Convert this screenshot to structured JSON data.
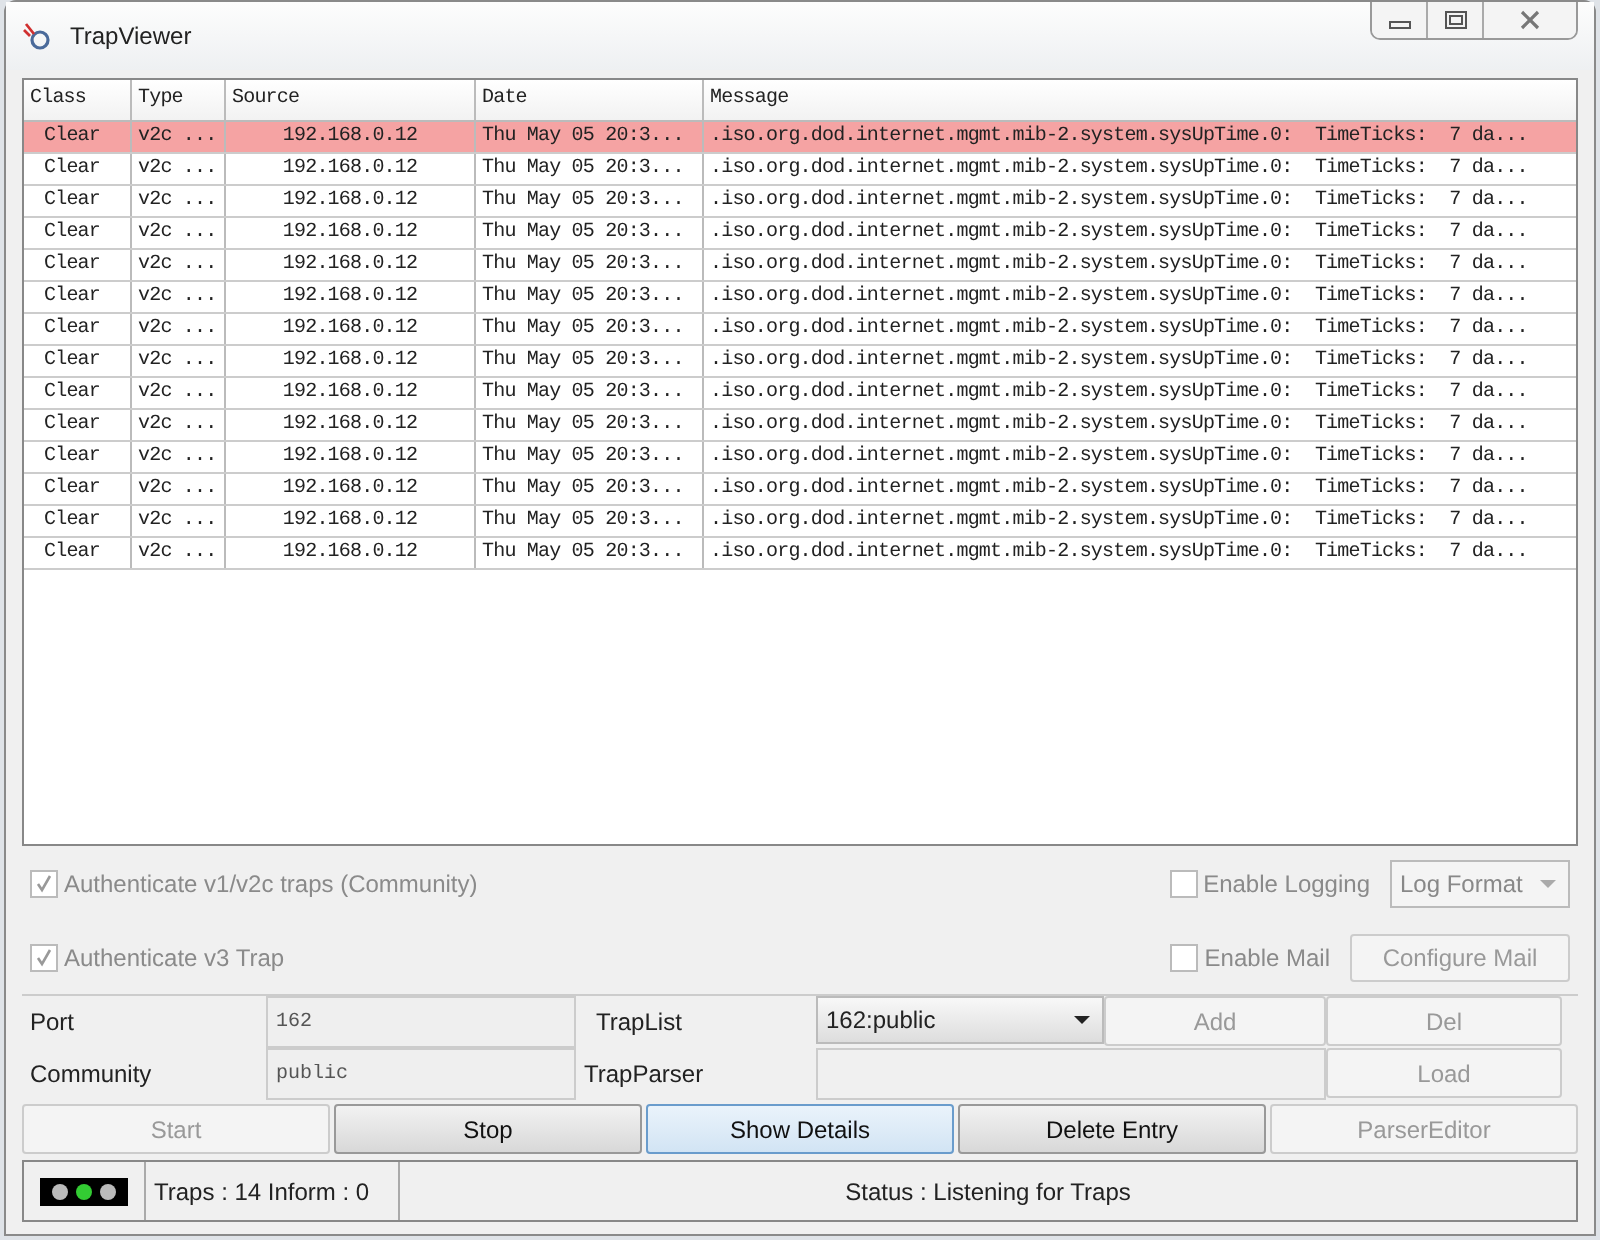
{
  "window": {
    "title": "TrapViewer"
  },
  "table": {
    "columns": [
      "Class",
      "Type",
      "Source",
      "Date",
      "Message"
    ],
    "rows": [
      {
        "selected": true,
        "cells": [
          "Clear",
          "v2c ...",
          "192.168.0.12",
          "Thu May 05 20:3...",
          ".iso.org.dod.internet.mgmt.mib-2.system.sysUpTime.0:  TimeTicks:  7 da..."
        ]
      },
      {
        "selected": false,
        "cells": [
          "Clear",
          "v2c ...",
          "192.168.0.12",
          "Thu May 05 20:3...",
          ".iso.org.dod.internet.mgmt.mib-2.system.sysUpTime.0:  TimeTicks:  7 da..."
        ]
      },
      {
        "selected": false,
        "cells": [
          "Clear",
          "v2c ...",
          "192.168.0.12",
          "Thu May 05 20:3...",
          ".iso.org.dod.internet.mgmt.mib-2.system.sysUpTime.0:  TimeTicks:  7 da..."
        ]
      },
      {
        "selected": false,
        "cells": [
          "Clear",
          "v2c ...",
          "192.168.0.12",
          "Thu May 05 20:3...",
          ".iso.org.dod.internet.mgmt.mib-2.system.sysUpTime.0:  TimeTicks:  7 da..."
        ]
      },
      {
        "selected": false,
        "cells": [
          "Clear",
          "v2c ...",
          "192.168.0.12",
          "Thu May 05 20:3...",
          ".iso.org.dod.internet.mgmt.mib-2.system.sysUpTime.0:  TimeTicks:  7 da..."
        ]
      },
      {
        "selected": false,
        "cells": [
          "Clear",
          "v2c ...",
          "192.168.0.12",
          "Thu May 05 20:3...",
          ".iso.org.dod.internet.mgmt.mib-2.system.sysUpTime.0:  TimeTicks:  7 da..."
        ]
      },
      {
        "selected": false,
        "cells": [
          "Clear",
          "v2c ...",
          "192.168.0.12",
          "Thu May 05 20:3...",
          ".iso.org.dod.internet.mgmt.mib-2.system.sysUpTime.0:  TimeTicks:  7 da..."
        ]
      },
      {
        "selected": false,
        "cells": [
          "Clear",
          "v2c ...",
          "192.168.0.12",
          "Thu May 05 20:3...",
          ".iso.org.dod.internet.mgmt.mib-2.system.sysUpTime.0:  TimeTicks:  7 da..."
        ]
      },
      {
        "selected": false,
        "cells": [
          "Clear",
          "v2c ...",
          "192.168.0.12",
          "Thu May 05 20:3...",
          ".iso.org.dod.internet.mgmt.mib-2.system.sysUpTime.0:  TimeTicks:  7 da..."
        ]
      },
      {
        "selected": false,
        "cells": [
          "Clear",
          "v2c ...",
          "192.168.0.12",
          "Thu May 05 20:3...",
          ".iso.org.dod.internet.mgmt.mib-2.system.sysUpTime.0:  TimeTicks:  7 da..."
        ]
      },
      {
        "selected": false,
        "cells": [
          "Clear",
          "v2c ...",
          "192.168.0.12",
          "Thu May 05 20:3...",
          ".iso.org.dod.internet.mgmt.mib-2.system.sysUpTime.0:  TimeTicks:  7 da..."
        ]
      },
      {
        "selected": false,
        "cells": [
          "Clear",
          "v2c ...",
          "192.168.0.12",
          "Thu May 05 20:3...",
          ".iso.org.dod.internet.mgmt.mib-2.system.sysUpTime.0:  TimeTicks:  7 da..."
        ]
      },
      {
        "selected": false,
        "cells": [
          "Clear",
          "v2c ...",
          "192.168.0.12",
          "Thu May 05 20:3...",
          ".iso.org.dod.internet.mgmt.mib-2.system.sysUpTime.0:  TimeTicks:  7 da..."
        ]
      },
      {
        "selected": false,
        "cells": [
          "Clear",
          "v2c ...",
          "192.168.0.12",
          "Thu May 05 20:3...",
          ".iso.org.dod.internet.mgmt.mib-2.system.sysUpTime.0:  TimeTicks:  7 da..."
        ]
      }
    ]
  },
  "options": {
    "auth_v1v2c": {
      "label": "Authenticate v1/v2c traps (Community)",
      "checked": true,
      "disabled": true
    },
    "auth_v3": {
      "label": "Authenticate v3 Trap",
      "checked": true,
      "disabled": true
    },
    "enable_logging": {
      "label": "Enable Logging",
      "checked": false,
      "disabled": true
    },
    "log_format": {
      "label": "Log Format",
      "disabled": true
    },
    "enable_mail": {
      "label": "Enable Mail",
      "checked": false,
      "disabled": true
    },
    "configure_mail": {
      "label": "Configure Mail",
      "disabled": true
    }
  },
  "settings": {
    "port_label": "Port",
    "port_value": "162",
    "community_label": "Community",
    "community_value": "public",
    "traplist_label": "TrapList",
    "traplist_value": "162:public",
    "trapparser_label": "TrapParser",
    "add": {
      "label": "Add",
      "disabled": true
    },
    "del": {
      "label": "Del",
      "disabled": true
    },
    "load": {
      "label": "Load",
      "disabled": true
    }
  },
  "buttons": [
    {
      "label": "Start",
      "disabled": true,
      "focused": false
    },
    {
      "label": "Stop",
      "disabled": false,
      "focused": false
    },
    {
      "label": "Show Details",
      "disabled": false,
      "focused": true
    },
    {
      "label": "Delete Entry",
      "disabled": false,
      "focused": false
    },
    {
      "label": "ParserEditor",
      "disabled": true,
      "focused": false
    }
  ],
  "status_bar": {
    "lights": [
      {
        "on": false
      },
      {
        "on": true
      },
      {
        "on": false
      }
    ],
    "counts": "Traps :  14 Inform :  0",
    "status": "Status : Listening for Traps"
  }
}
